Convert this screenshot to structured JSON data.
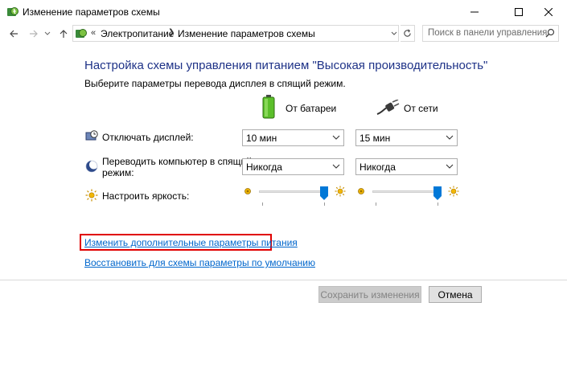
{
  "window": {
    "title": "Изменение параметров схемы",
    "icon": "power-options-icon"
  },
  "nav": {
    "breadcrumb": [
      "Электропитание",
      "Изменение параметров схемы"
    ],
    "breadcrumb_prefix": "«",
    "search_placeholder": "Поиск в панели управления"
  },
  "content": {
    "heading": "Настройка схемы управления питанием \"Высокая производительность\"",
    "subheading": "Выберите параметры перевода дисплея в спящий режим.",
    "columns": {
      "battery": "От батареи",
      "plugged": "От сети"
    },
    "rows": {
      "display": {
        "label": "Отключать дисплей:",
        "battery": "10 мин",
        "plugged": "15 мин"
      },
      "sleep": {
        "label_line1": "Переводить компьютер в спящий",
        "label_line2": "режим:",
        "battery": "Никогда",
        "plugged": "Никогда"
      },
      "brightness": {
        "label": "Настроить яркость:",
        "battery_level": 100,
        "plugged_level": 100
      }
    },
    "links": {
      "advanced": "Изменить дополнительные параметры питания",
      "restore": "Восстановить для схемы параметры по умолчанию"
    }
  },
  "footer": {
    "save": "Сохранить изменения",
    "cancel": "Отмена"
  },
  "colors": {
    "heading": "#1e3287",
    "link": "#0066cc",
    "highlight": "#e00000",
    "slider_thumb": "#0078d7"
  }
}
